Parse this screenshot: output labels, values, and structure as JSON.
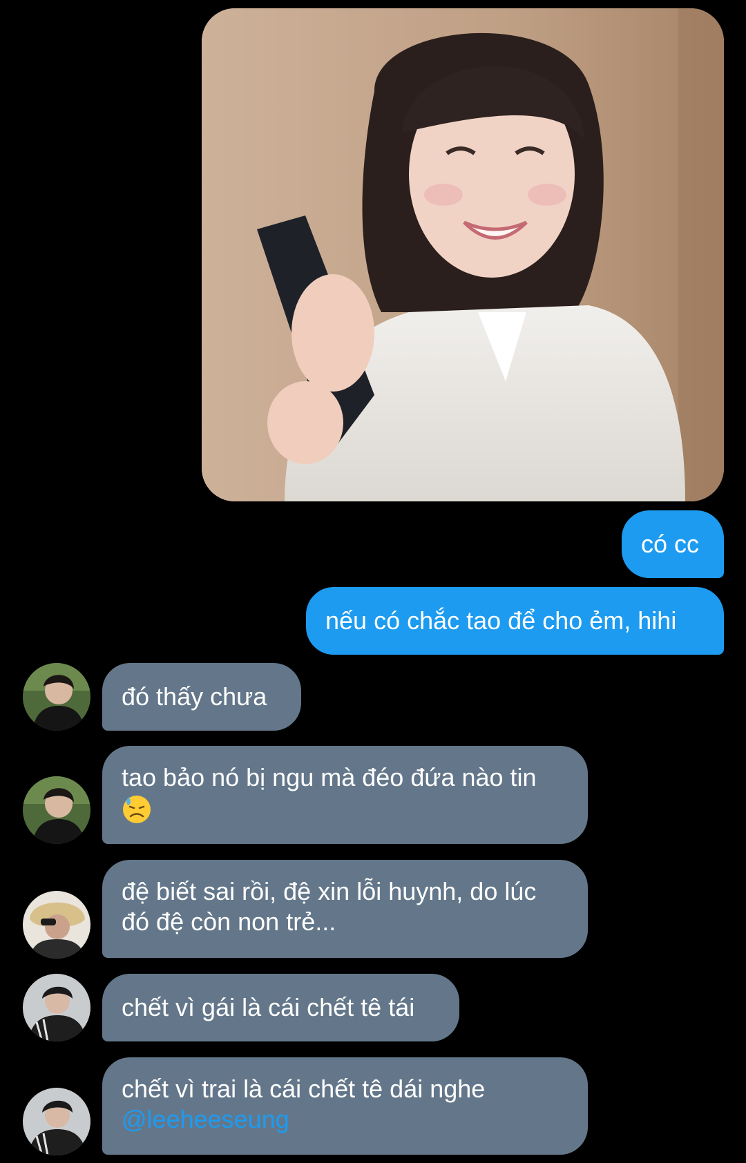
{
  "messages": {
    "image": {
      "content": "photo"
    },
    "out_1": {
      "text": "có cc"
    },
    "out_2": {
      "text": "nếu có chắc tao để cho ẻm, hihi"
    },
    "in_1": {
      "text": "đó thấy chưa"
    },
    "in_2": {
      "text": "tao bảo nó bị ngu mà đéo đứa nào tin",
      "emoji": "downcast-face-with-sweat"
    },
    "in_3": {
      "line1": "đệ biết sai rồi, đệ xin lỗi huynh, do lúc",
      "line2": "đó đệ còn non trẻ..."
    },
    "in_4": {
      "text": "chết vì gái là cái chết tê tái"
    },
    "in_5": {
      "text": "chết vì trai là cái chết tê dái nghe",
      "mention": "@leeheeseung"
    }
  },
  "colors": {
    "background": "#000000",
    "outgoing_bubble": "#1d9bf0",
    "incoming_bubble": "#64778a",
    "mention": "#1d9bf0",
    "text": "#ffffff"
  }
}
